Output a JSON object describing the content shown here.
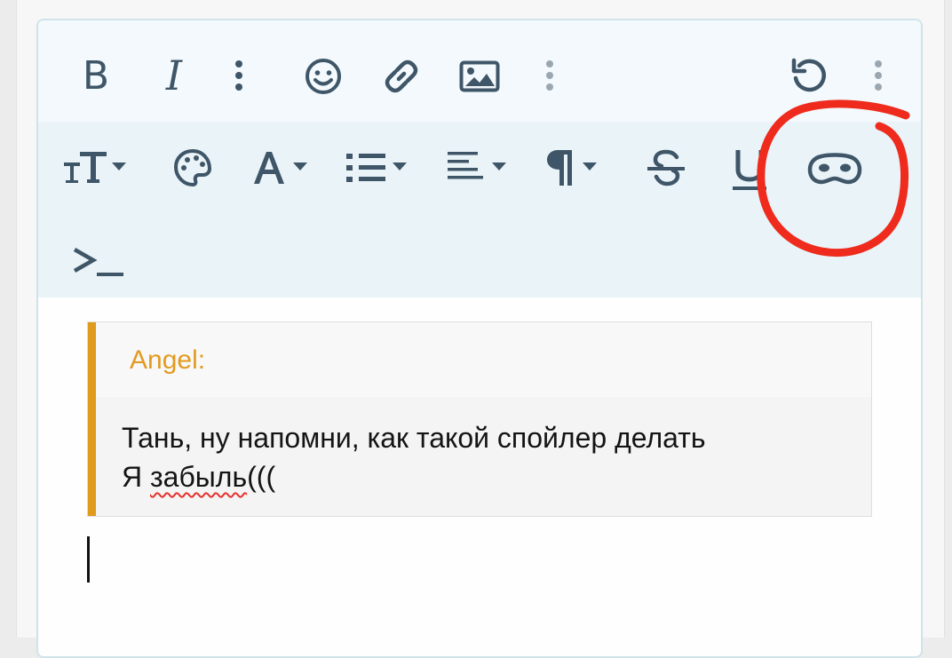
{
  "toolbar": {
    "row1": [
      {
        "name": "bold-button",
        "label": "B",
        "icon": "bold"
      },
      {
        "name": "italic-button",
        "label": "I",
        "icon": "italic"
      },
      {
        "name": "more-text-options-button",
        "icon": "vertical-ellipsis"
      },
      {
        "name": "emoji-button",
        "icon": "smiley-face"
      },
      {
        "name": "link-button",
        "icon": "chain-link"
      },
      {
        "name": "image-button",
        "icon": "image"
      },
      {
        "name": "more-insert-options-button",
        "icon": "vertical-ellipsis"
      },
      {
        "name": "undo-button",
        "icon": "undo-arrow"
      },
      {
        "name": "more-options-button",
        "icon": "vertical-ellipsis"
      }
    ],
    "row2": [
      {
        "name": "font-size-dropdown",
        "icon": "text-size"
      },
      {
        "name": "text-color-button",
        "icon": "palette"
      },
      {
        "name": "font-family-dropdown",
        "icon": "letter-a"
      },
      {
        "name": "list-dropdown",
        "icon": "bulleted-list"
      },
      {
        "name": "align-dropdown",
        "icon": "align-left"
      },
      {
        "name": "paragraph-dropdown",
        "icon": "pilcrow"
      },
      {
        "name": "strikethrough-button",
        "icon": "strikethrough"
      },
      {
        "name": "underline-button",
        "icon": "underline"
      },
      {
        "name": "spoiler-button",
        "icon": "mask"
      },
      {
        "name": "code-inline-button",
        "icon": "terminal-prompt"
      }
    ]
  },
  "quote": {
    "author": "Angel:",
    "line1": "Тань, ну напомни, как такой спойлер делать",
    "line2_prefix": "Я ",
    "line2_misspelled": "забыль",
    "line2_suffix": "((("
  },
  "annotation": {
    "type": "hand-drawn circle",
    "color": "#ee2b1c",
    "target": "spoiler-button"
  },
  "colors": {
    "icon": "#3f5668",
    "quote_accent": "#e09a1c",
    "toolbar_row1_bg": "#f3f9fc",
    "toolbar_row2_bg": "#e9f3f8"
  }
}
